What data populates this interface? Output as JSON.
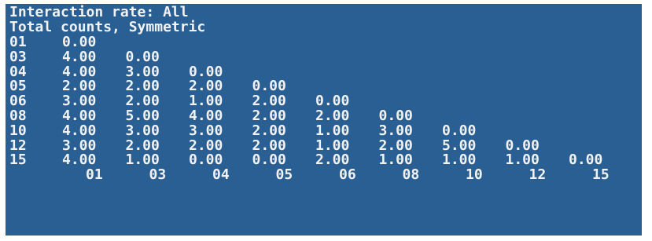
{
  "console": {
    "title_line": "Interaction rate: All",
    "subtitle_line": "Total counts, Symmetric",
    "rows": [
      {
        "label": "01",
        "values": [
          "0.00"
        ]
      },
      {
        "label": "03",
        "values": [
          "4.00",
          "0.00"
        ]
      },
      {
        "label": "04",
        "values": [
          "4.00",
          "3.00",
          "0.00"
        ]
      },
      {
        "label": "05",
        "values": [
          "2.00",
          "2.00",
          "2.00",
          "0.00"
        ]
      },
      {
        "label": "06",
        "values": [
          "3.00",
          "2.00",
          "1.00",
          "2.00",
          "0.00"
        ]
      },
      {
        "label": "08",
        "values": [
          "4.00",
          "5.00",
          "4.00",
          "2.00",
          "2.00",
          "0.00"
        ]
      },
      {
        "label": "10",
        "values": [
          "4.00",
          "3.00",
          "3.00",
          "2.00",
          "1.00",
          "3.00",
          "0.00"
        ]
      },
      {
        "label": "12",
        "values": [
          "3.00",
          "2.00",
          "2.00",
          "2.00",
          "1.00",
          "2.00",
          "5.00",
          "0.00"
        ]
      },
      {
        "label": "15",
        "values": [
          "4.00",
          "1.00",
          "0.00",
          "0.00",
          "2.00",
          "1.00",
          "1.00",
          "1.00",
          "0.00"
        ]
      }
    ],
    "column_labels": [
      "01",
      "03",
      "04",
      "05",
      "06",
      "08",
      "10",
      "12",
      "15"
    ]
  },
  "colors": {
    "background": "#2a5f93",
    "text": "#f2f2f2"
  }
}
